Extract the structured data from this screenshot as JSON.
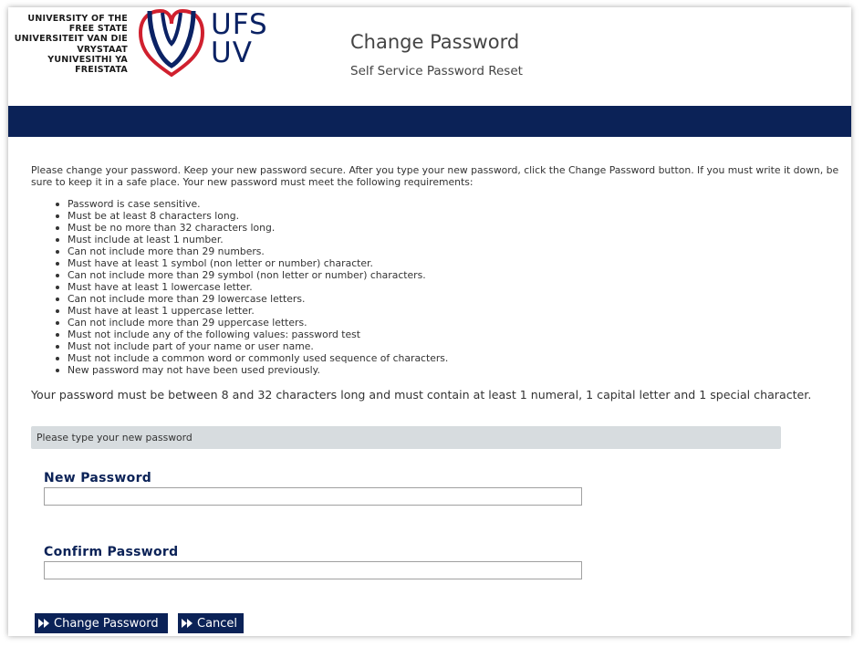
{
  "header": {
    "logo_lines": [
      "UNIVERSITY OF THE",
      "FREE STATE",
      "UNIVERSITEIT VAN DIE",
      "VRYSTAAT",
      "YUNIVESITHI YA",
      "FREISTATA"
    ],
    "logo_abbrev_1": "UFS",
    "logo_abbrev_2": "UV",
    "title": "Change Password",
    "subtitle": "Self Service Password Reset"
  },
  "colors": {
    "navy": "#0b2257",
    "red": "#d0202e",
    "prompt_bar": "#d7dcdf"
  },
  "intro": "Please change your password. Keep your new password secure. After you type your new password, click the Change Password button. If you must write it down, be sure to keep it in a safe place. Your new password must meet the following requirements:",
  "requirements": [
    "Password is case sensitive.",
    "Must be at least 8 characters long.",
    "Must be no more than 32 characters long.",
    "Must include at least 1 number.",
    "Can not include more than 29 numbers.",
    "Must have at least 1 symbol (non letter or number) character.",
    "Can not include more than 29 symbol (non letter or number) characters.",
    "Must have at least 1 lowercase letter.",
    "Can not include more than 29 lowercase letters.",
    "Must have at least 1 uppercase letter.",
    "Can not include more than 29 uppercase letters.",
    "Must not include any of the following values: password test",
    "Must not include part of your name or user name.",
    "Must not include a common word or commonly used sequence of characters.",
    "New password may not have been used previously."
  ],
  "summary": "Your password must be between 8 and 32 characters long and must contain at least 1 numeral, 1 capital letter and 1 special character.",
  "prompt": "Please type your new password",
  "form": {
    "new_password_label": "New Password",
    "new_password_value": "",
    "confirm_password_label": "Confirm Password",
    "confirm_password_value": ""
  },
  "buttons": {
    "change_password": "Change Password",
    "cancel": "Cancel",
    "icon": "double-chevron-right-icon"
  }
}
